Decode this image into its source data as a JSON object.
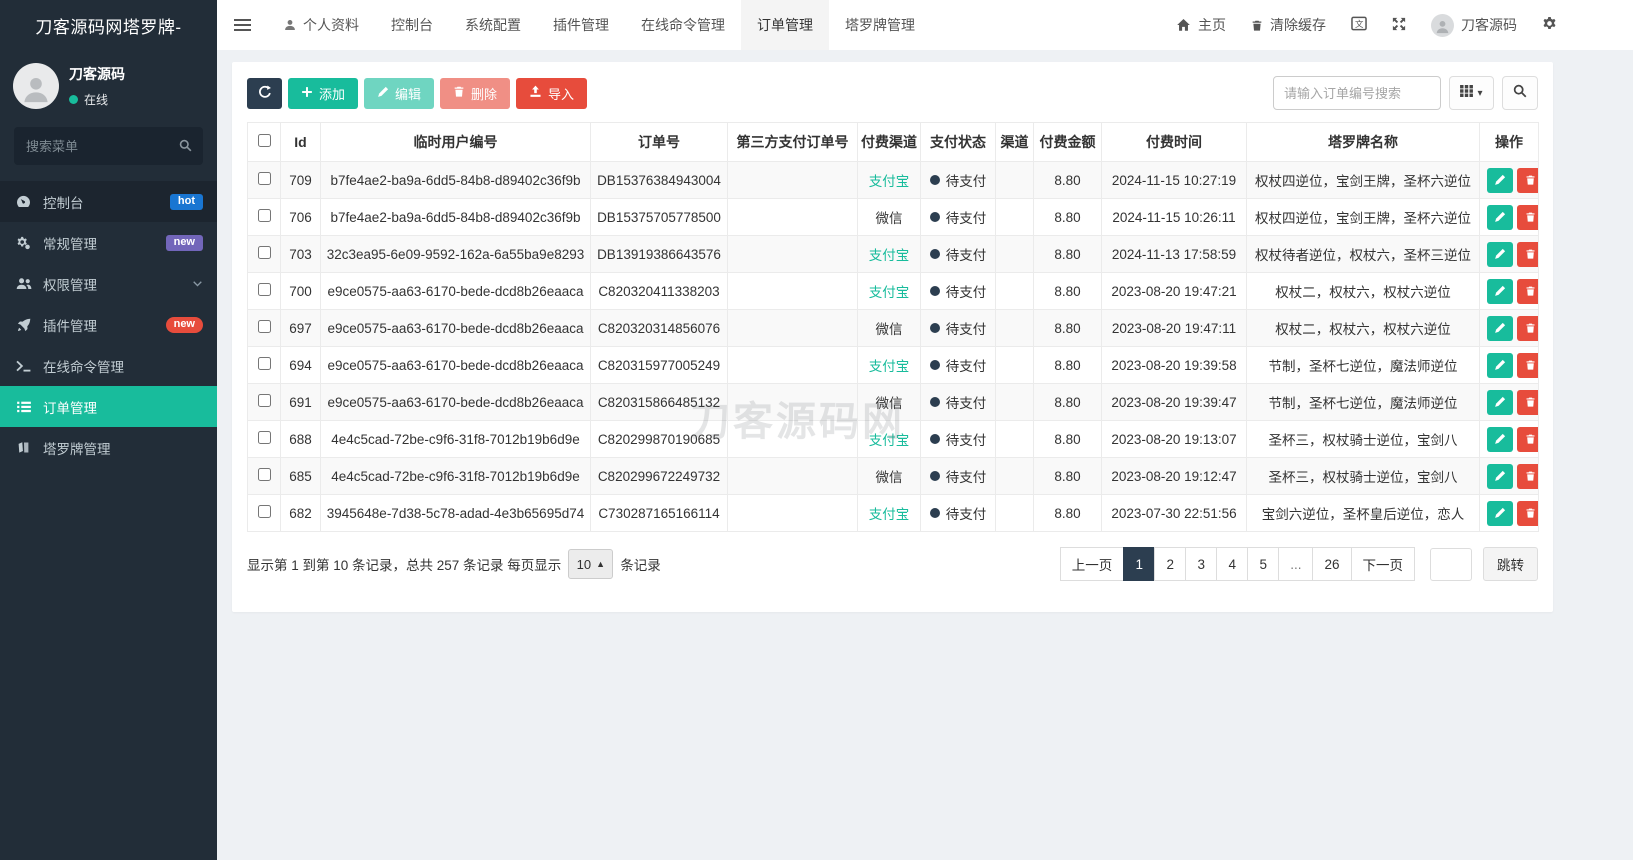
{
  "colors": {
    "accent_green": "#18bc9c",
    "dark_navy": "#2c3e50",
    "danger_red": "#e74c3c",
    "badge_blue": "#1976d2",
    "badge_purple": "#7266ba",
    "sidebar_bg": "#222d38",
    "alipay_text": "#18bc9c"
  },
  "sidebar": {
    "logo": "刀客源码网塔罗牌-",
    "user": {
      "name": "刀客源码",
      "status": "在线"
    },
    "search_placeholder": "搜索菜单",
    "items": [
      {
        "label": "控制台",
        "icon": "dashboard-icon",
        "badge": "hot",
        "badge_style": "blue",
        "active": false
      },
      {
        "label": "常规管理",
        "icon": "gears-icon",
        "badge": "new",
        "badge_style": "purple",
        "active": false
      },
      {
        "label": "权限管理",
        "icon": "users-icon",
        "chevron": true,
        "active": false
      },
      {
        "label": "插件管理",
        "icon": "rocket-icon",
        "badge": "new",
        "badge_style": "red-pill",
        "active": false
      },
      {
        "label": "在线命令管理",
        "icon": "terminal-icon",
        "active": false
      },
      {
        "label": "订单管理",
        "icon": "list-icon",
        "active": true
      },
      {
        "label": "塔罗牌管理",
        "icon": "tarot-icon",
        "active": false
      }
    ]
  },
  "navbar": {
    "tabs": [
      {
        "label": "个人资料",
        "icon": "user-icon",
        "active": false
      },
      {
        "label": "控制台",
        "active": false
      },
      {
        "label": "系统配置",
        "active": false
      },
      {
        "label": "插件管理",
        "active": false
      },
      {
        "label": "在线命令管理",
        "active": false
      },
      {
        "label": "订单管理",
        "active": true
      },
      {
        "label": "塔罗牌管理",
        "active": false
      }
    ],
    "right": {
      "home_label": "主页",
      "clear_cache_label": "清除缓存",
      "username": "刀客源码"
    }
  },
  "toolbar": {
    "add_label": "添加",
    "edit_label": "编辑",
    "delete_label": "删除",
    "import_label": "导入",
    "search_placeholder": "请输入订单编号搜索"
  },
  "table": {
    "columns": [
      "Id",
      "临时用户编号",
      "订单号",
      "第三方支付订单号",
      "付费渠道",
      "支付状态",
      "渠道",
      "付费金额",
      "付费时间",
      "塔罗牌名称",
      "操作"
    ],
    "rows": [
      {
        "id": "709",
        "user_no": "b7fe4ae2-ba9a-6dd5-84b8-d89402c36f9b",
        "order_no": "DB15376384943004",
        "third_party_no": "",
        "pay_channel": "支付宝",
        "pay_status": "待支付",
        "channel": "",
        "amount": "8.80",
        "pay_time": "2024-11-15 10:27:19",
        "tarot": "权杖四逆位，宝剑王牌，圣杯六逆位"
      },
      {
        "id": "706",
        "user_no": "b7fe4ae2-ba9a-6dd5-84b8-d89402c36f9b",
        "order_no": "DB15375705778500",
        "third_party_no": "",
        "pay_channel": "微信",
        "pay_status": "待支付",
        "channel": "",
        "amount": "8.80",
        "pay_time": "2024-11-15 10:26:11",
        "tarot": "权杖四逆位，宝剑王牌，圣杯六逆位"
      },
      {
        "id": "703",
        "user_no": "32c3ea95-6e09-9592-162a-6a55ba9e8293",
        "order_no": "DB13919386643576",
        "third_party_no": "",
        "pay_channel": "支付宝",
        "pay_status": "待支付",
        "channel": "",
        "amount": "8.80",
        "pay_time": "2024-11-13 17:58:59",
        "tarot": "权杖待者逆位，权杖六，圣杯三逆位"
      },
      {
        "id": "700",
        "user_no": "e9ce0575-aa63-6170-bede-dcd8b26eaaca",
        "order_no": "C820320411338203",
        "third_party_no": "",
        "pay_channel": "支付宝",
        "pay_status": "待支付",
        "channel": "",
        "amount": "8.80",
        "pay_time": "2023-08-20 19:47:21",
        "tarot": "权杖二，权杖六，权杖六逆位"
      },
      {
        "id": "697",
        "user_no": "e9ce0575-aa63-6170-bede-dcd8b26eaaca",
        "order_no": "C820320314856076",
        "third_party_no": "",
        "pay_channel": "微信",
        "pay_status": "待支付",
        "channel": "",
        "amount": "8.80",
        "pay_time": "2023-08-20 19:47:11",
        "tarot": "权杖二，权杖六，权杖六逆位"
      },
      {
        "id": "694",
        "user_no": "e9ce0575-aa63-6170-bede-dcd8b26eaaca",
        "order_no": "C820315977005249",
        "third_party_no": "",
        "pay_channel": "支付宝",
        "pay_status": "待支付",
        "channel": "",
        "amount": "8.80",
        "pay_time": "2023-08-20 19:39:58",
        "tarot": "节制，圣杯七逆位，魔法师逆位"
      },
      {
        "id": "691",
        "user_no": "e9ce0575-aa63-6170-bede-dcd8b26eaaca",
        "order_no": "C820315866485132",
        "third_party_no": "",
        "pay_channel": "微信",
        "pay_status": "待支付",
        "channel": "",
        "amount": "8.80",
        "pay_time": "2023-08-20 19:39:47",
        "tarot": "节制，圣杯七逆位，魔法师逆位"
      },
      {
        "id": "688",
        "user_no": "4e4c5cad-72be-c9f6-31f8-7012b19b6d9e",
        "order_no": "C820299870190685",
        "third_party_no": "",
        "pay_channel": "支付宝",
        "pay_status": "待支付",
        "channel": "",
        "amount": "8.80",
        "pay_time": "2023-08-20 19:13:07",
        "tarot": "圣杯三，权杖骑士逆位，宝剑八"
      },
      {
        "id": "685",
        "user_no": "4e4c5cad-72be-c9f6-31f8-7012b19b6d9e",
        "order_no": "C820299672249732",
        "third_party_no": "",
        "pay_channel": "微信",
        "pay_status": "待支付",
        "channel": "",
        "amount": "8.80",
        "pay_time": "2023-08-20 19:12:47",
        "tarot": "圣杯三，权杖骑士逆位，宝剑八"
      },
      {
        "id": "682",
        "user_no": "3945648e-7d38-5c78-adad-4e3b65695d74",
        "order_no": "C730287165166114",
        "third_party_no": "",
        "pay_channel": "支付宝",
        "pay_status": "待支付",
        "channel": "",
        "amount": "8.80",
        "pay_time": "2023-07-30 22:51:56",
        "tarot": "宝剑六逆位，圣杯皇后逆位，恋人"
      }
    ]
  },
  "pagination": {
    "info_prefix": "显示第 1 到第 10 条记录，总共 257 条记录 每页显示",
    "page_size": "10",
    "info_suffix": "条记录",
    "prev_label": "上一页",
    "next_label": "下一页",
    "pages": [
      "1",
      "2",
      "3",
      "4",
      "5",
      "...",
      "26"
    ],
    "active_page": "1",
    "jump_label": "跳转"
  },
  "watermark": "刀客源码网"
}
